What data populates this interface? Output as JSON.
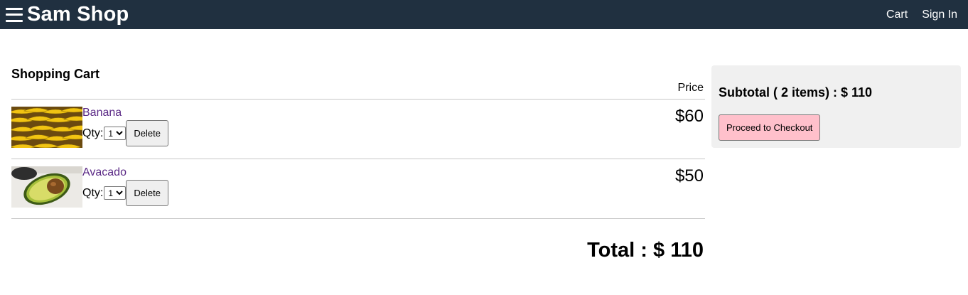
{
  "header": {
    "brand": "Sam Shop",
    "nav": {
      "cart": "Cart",
      "signin": "Sign In"
    },
    "bg_color": "#203040"
  },
  "cart": {
    "title": "Shopping Cart",
    "price_header": "Price",
    "qty_label": "Qty:",
    "delete_label": "Delete",
    "items": [
      {
        "name": "Banana",
        "qty": "1",
        "price": "$60",
        "image": "banana-photo"
      },
      {
        "name": "Avacado",
        "qty": "1",
        "price": "$50",
        "image": "avocado-photo"
      }
    ],
    "total": "Total : $ 110"
  },
  "summary": {
    "subtotal": "Subtotal ( 2 items) : $ 110",
    "checkout_label": "Proceed to Checkout",
    "checkout_color": "#ffc0cb"
  }
}
